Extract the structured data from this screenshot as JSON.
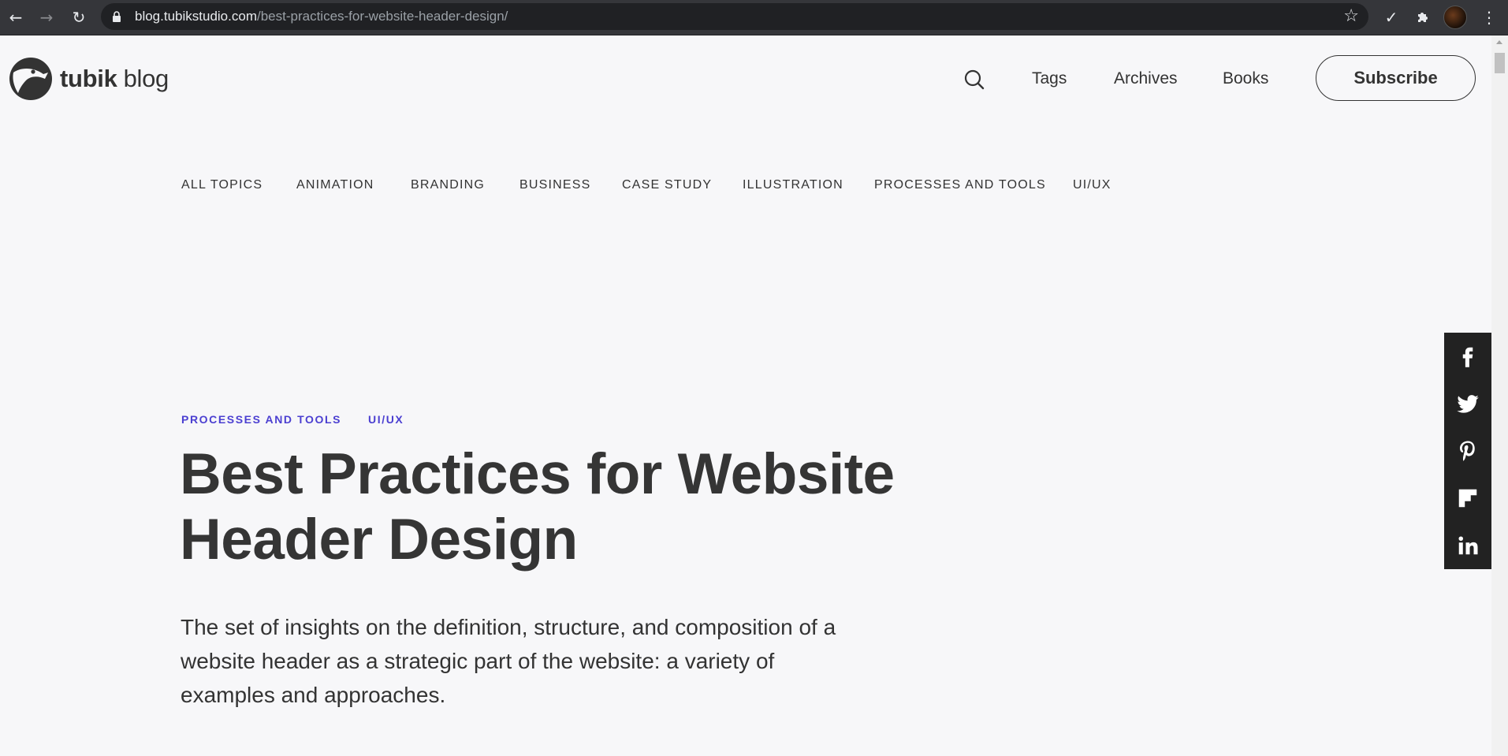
{
  "browser": {
    "url_host": "blog.tubikstudio.com",
    "url_path": "/best-practices-for-website-header-design/",
    "icons": [
      "back-arrow-icon",
      "forward-arrow-icon",
      "reload-icon",
      "lock-icon",
      "star-icon",
      "checkmark-icon",
      "puzzle-icon",
      "menu-dots-icon"
    ]
  },
  "header": {
    "logo_brand": "tubik",
    "logo_suffix": "blog",
    "nav": [
      "Tags",
      "Archives",
      "Books"
    ],
    "subscribe_label": "Subscribe"
  },
  "topics": [
    "ALL TOPICS",
    "ANIMATION",
    "BRANDING",
    "BUSINESS",
    "CASE STUDY",
    "ILLUSTRATION",
    "PROCESSES AND TOOLS",
    "UI/UX"
  ],
  "article": {
    "tags": [
      "PROCESSES AND TOOLS",
      "UI/UX"
    ],
    "title_line1": "Best Practices for Website",
    "title_line2": "Header Design",
    "lead": "The set of insights on the definition, structure, and composition of a website header as a strategic part of the website: a variety of examples and approaches."
  },
  "share": [
    "facebook-icon",
    "twitter-icon",
    "pinterest-icon",
    "flipboard-icon",
    "linkedin-icon"
  ],
  "colors": {
    "accent": "#4b3fd1",
    "page_bg": "#f7f7f9",
    "text": "#333333",
    "share_bg": "#222222"
  }
}
